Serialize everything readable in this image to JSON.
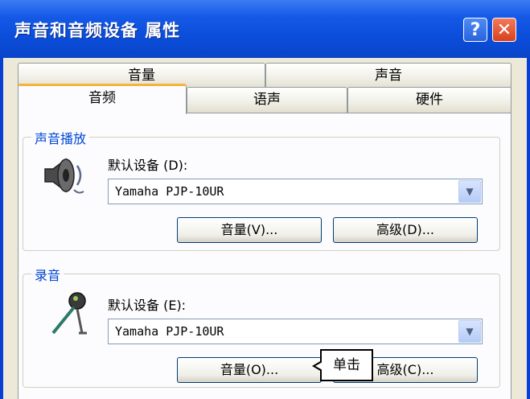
{
  "window": {
    "title": "声音和音频设备 属性",
    "help_label": "?",
    "close_label": "✕"
  },
  "tabs": {
    "upper": [
      {
        "label": "音量"
      },
      {
        "label": "声音"
      }
    ],
    "lower": [
      {
        "label": "音频",
        "active": true
      },
      {
        "label": "语声"
      },
      {
        "label": "硬件"
      }
    ]
  },
  "playback": {
    "legend": "声音播放",
    "icon": "speaker-icon",
    "default_label": "默认设备 (D):",
    "device_value": "Yamaha PJP-10UR",
    "volume_button": "音量(V)...",
    "advanced_button": "高级(D)..."
  },
  "recording": {
    "legend": "录音",
    "icon": "microphone-icon",
    "default_label": "默认设备 (E):",
    "device_value": "Yamaha PJP-10UR",
    "volume_button": "音量(O)...",
    "advanced_button": "高级(C)..."
  },
  "callout": {
    "text": "单击"
  },
  "colors": {
    "titlebar": "#0a4cd8",
    "legend_text": "#0046d5",
    "active_tab_accent": "#f6b33b",
    "close_button": "#d8401c"
  }
}
